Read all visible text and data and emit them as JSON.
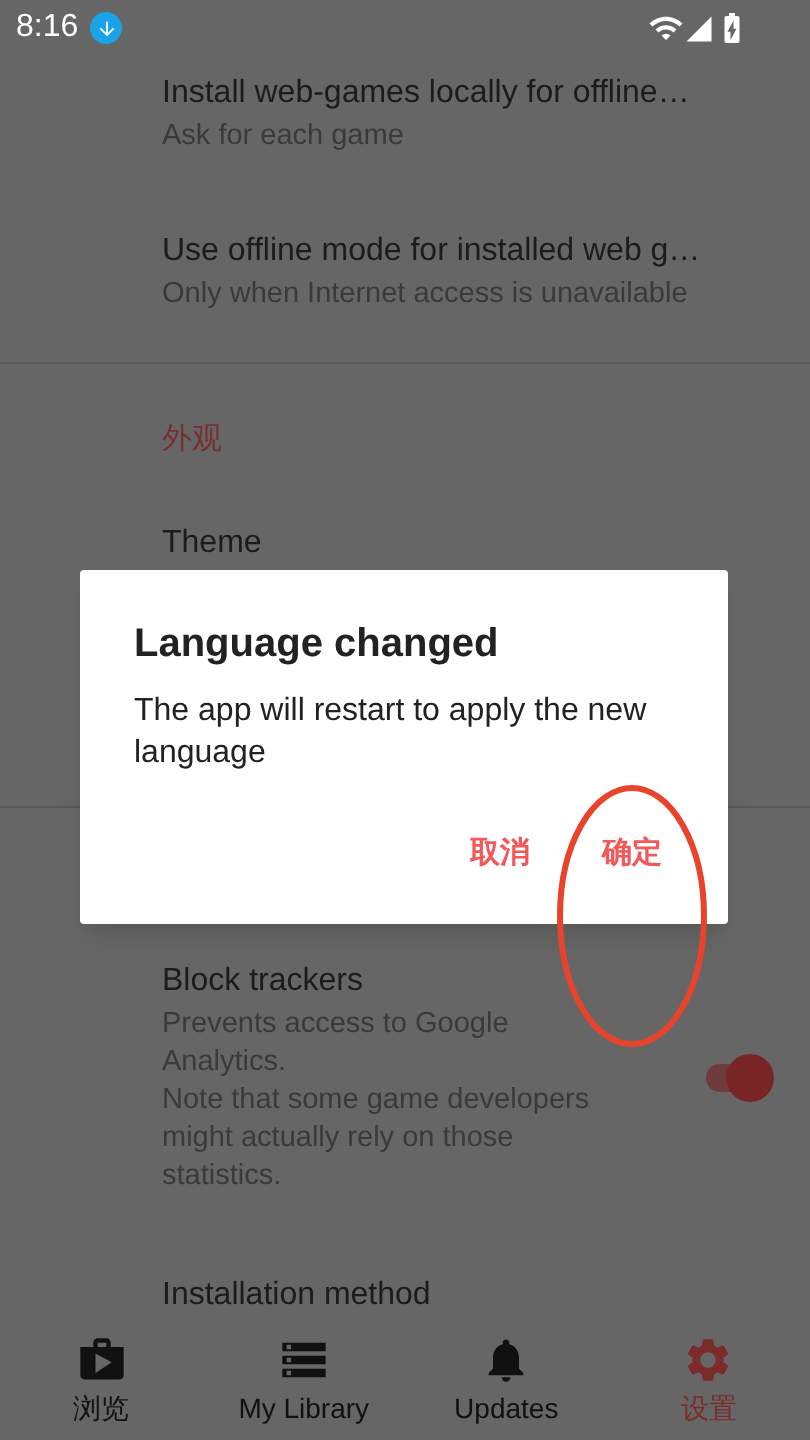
{
  "status_bar": {
    "time": "8:16"
  },
  "sections": [
    {
      "items": [
        {
          "kind": "option",
          "title": "Install web-games locally for offline…",
          "subtitle": "Ask for each game"
        },
        {
          "kind": "option",
          "title": "Use offline mode for installed web g…",
          "subtitle": "Only when Internet access is unavailable"
        }
      ]
    },
    {
      "header": "外观",
      "items": [
        {
          "kind": "plain",
          "title": "Theme"
        }
      ]
    },
    {
      "items": [
        {
          "kind": "toggle",
          "title": "Block trackers",
          "subtitle": "Prevents access to Google Analytics.\nNote that some game developers might actually rely on those statistics.",
          "on": true
        },
        {
          "kind": "plain",
          "title": "Installation method"
        }
      ]
    }
  ],
  "dialog": {
    "title": "Language changed",
    "message": "The app will restart to apply the new language",
    "buttons": [
      "取消",
      "确定"
    ]
  },
  "nav": [
    {
      "label": "浏览",
      "selected": false
    },
    {
      "label": "My Library",
      "selected": false
    },
    {
      "label": "Updates",
      "selected": false
    },
    {
      "label": "设置",
      "selected": true
    }
  ]
}
